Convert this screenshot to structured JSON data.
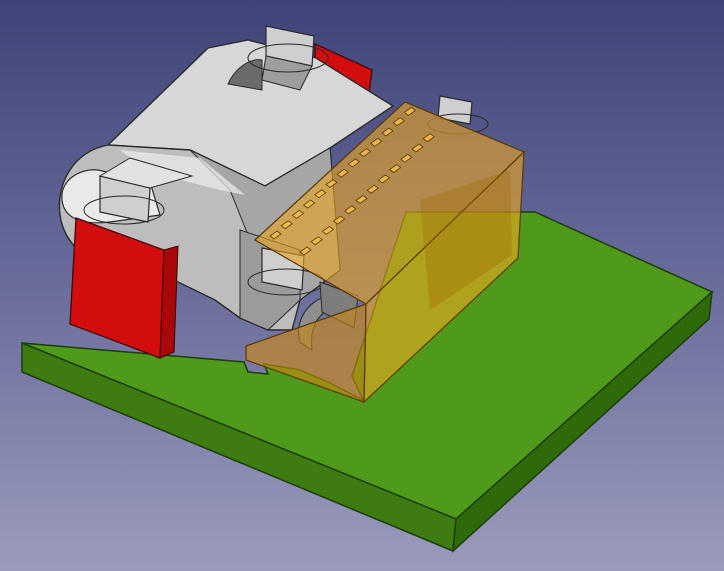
{
  "viewport": {
    "kind": "3d-cad-view",
    "background_top": "#3f4478",
    "background_bottom": "#9a9bbc"
  },
  "model": {
    "pcb": {
      "top": "#4f9a1a",
      "side_front": "#3c7c10",
      "side_right": "#2f6a0a",
      "edge": "#1d3d08"
    },
    "shell": {
      "light": "#dcdcdc",
      "mid": "#bdbdbd",
      "dark": "#8f8f8f",
      "edge": "#2a2a2a"
    },
    "pads": {
      "face": "#d10d0d",
      "side": "#a80808",
      "edge": "#3a0000"
    },
    "insulator": {
      "front": "#f0a91f",
      "top": "#e7a524",
      "side": "#c98812",
      "opacity": 0.62,
      "edge": "#5a3800"
    },
    "contact_count_rows": 2
  }
}
